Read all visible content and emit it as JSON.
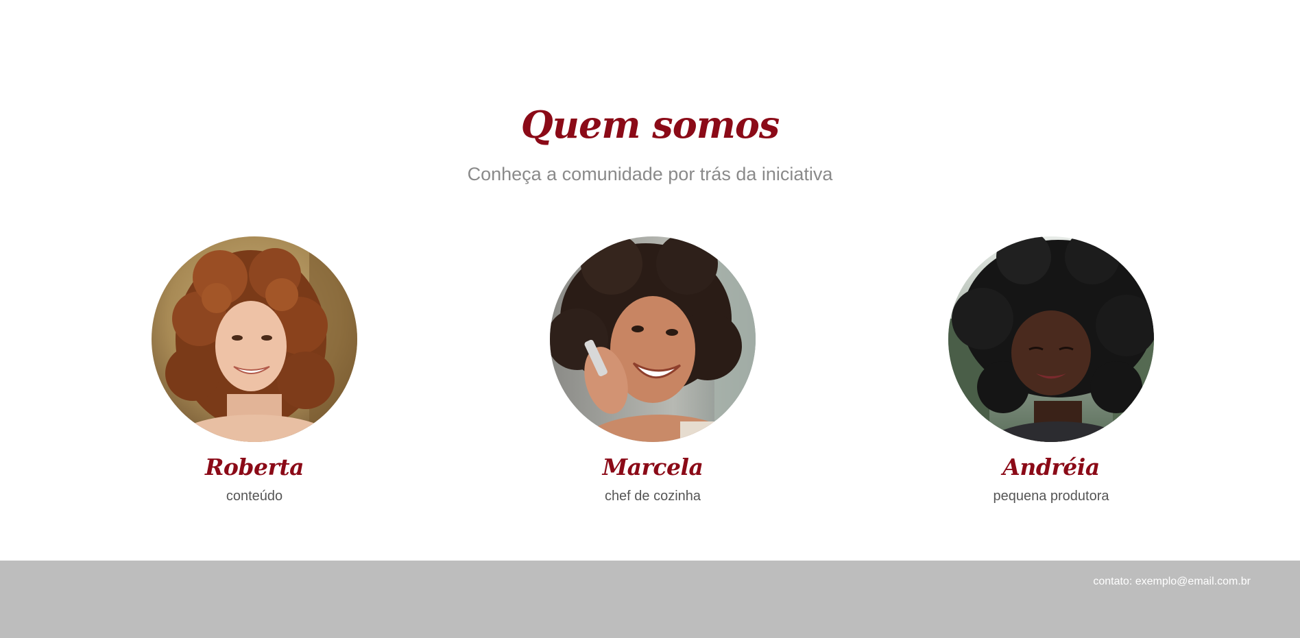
{
  "about": {
    "title": "Quem somos",
    "subtitle": "Conheça a comunidade por trás da iniciativa"
  },
  "members": [
    {
      "name": "Roberta",
      "role": "conteúdo",
      "photo_icon": "woman-curly-red-hair-photo"
    },
    {
      "name": "Marcela",
      "role": "chef de cozinha",
      "photo_icon": "woman-on-phone-photo"
    },
    {
      "name": "Andréia",
      "role": "pequena produtora",
      "photo_icon": "woman-dark-curly-hair-photo"
    }
  ],
  "footer": {
    "contact": "contato: exemplo@email.com.br"
  },
  "colors": {
    "accent": "#8b0a17",
    "footer_bg": "#bdbdbd",
    "subtitle": "#8a8a8a",
    "role_text": "#555555"
  }
}
